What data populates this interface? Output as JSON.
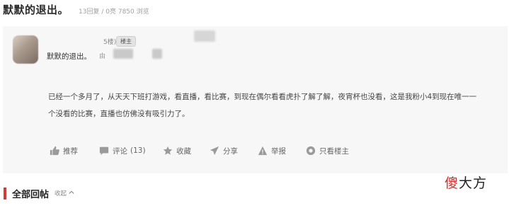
{
  "thread": {
    "title": "默默的退出。",
    "replies": "13回复",
    "likes": "0亮",
    "views": "7850",
    "views_suffix": "浏览"
  },
  "post": {
    "floor_text": "5楼)",
    "op_badge": "楼主",
    "author": "默默的退出。",
    "from_prefix": "由",
    "content": "已经一个多月了，从天天下班打游戏，看直播，看比赛，到现在偶尔看看虎扑了解了解，夜宵杯也没看，这是我粉小4到现在唯一一个没看的比赛，直播也仿佛没有吸引力了。",
    "actions": {
      "recommend": "推荐",
      "comment": "评论",
      "comment_count": "(13)",
      "favorite": "收藏",
      "share": "分享",
      "report": "举报",
      "only_op": "只看楼主"
    }
  },
  "section": {
    "title": "全部回帖",
    "collapse": "收起"
  },
  "watermark": {
    "char1": "傻",
    "rest": "大方"
  },
  "colors": {
    "accent_red": "#d33a3a",
    "post_bg": "#f7f7f7"
  }
}
